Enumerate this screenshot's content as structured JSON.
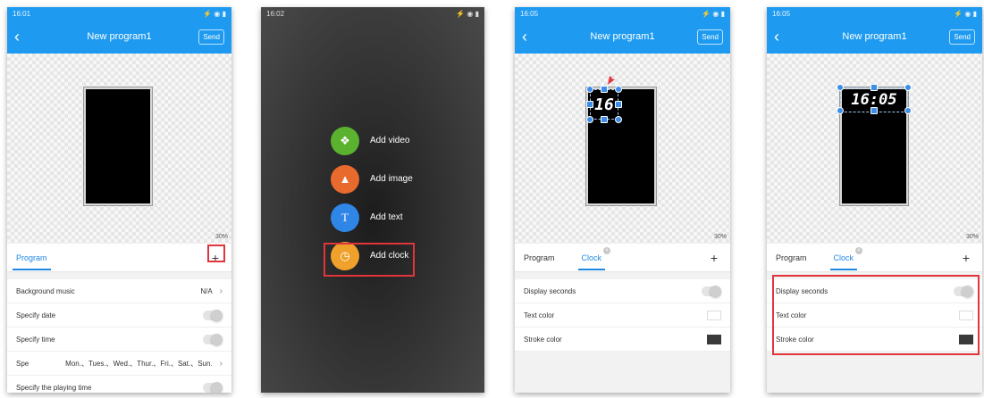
{
  "app": {
    "title": "New program1",
    "send_label": "Send",
    "back_icon": "back-arrow-icon"
  },
  "colors": {
    "accent": "#1e9bf0",
    "tab_active": "#1e88e5",
    "highlight": "#e0353b"
  },
  "screens": [
    {
      "time": "16:01",
      "zoom": "30%",
      "tabs": [
        "Program"
      ],
      "plus": "+",
      "rows": [
        {
          "label": "Background music",
          "value": "N/A",
          "control": "chevron"
        },
        {
          "label": "Specify date",
          "control": "toggle"
        },
        {
          "label": "Specify time",
          "control": "toggle"
        },
        {
          "label": "Spe",
          "value": "Mon.、Tues.、Wed.、Thur.、Fri.、Sat.、Sun.",
          "control": "chevron"
        },
        {
          "label": "Specify the playing time",
          "control": "toggle"
        }
      ]
    },
    {
      "time": "16:02",
      "menu": [
        {
          "label": "Add video",
          "icon": "video-icon",
          "color": "#5bb22e"
        },
        {
          "label": "Add image",
          "icon": "image-icon",
          "color": "#e96a2d"
        },
        {
          "label": "Add text",
          "icon": "text-icon",
          "color": "#2f86e6"
        },
        {
          "label": "Add clock",
          "icon": "clock-icon",
          "color": "#f0a12b"
        }
      ]
    },
    {
      "time": "16:05",
      "zoom": "30%",
      "clock_text": "16",
      "tabs": [
        "Program",
        "Clock"
      ],
      "plus": "+",
      "rows": [
        {
          "label": "Display seconds",
          "control": "toggle"
        },
        {
          "label": "Text color",
          "control": "swatch-white"
        },
        {
          "label": "Stroke color",
          "control": "swatch-dark"
        }
      ]
    },
    {
      "time": "16:05",
      "zoom": "30%",
      "clock_text": "16:05",
      "tabs": [
        "Program",
        "Clock"
      ],
      "plus": "+",
      "rows": [
        {
          "label": "Display seconds",
          "control": "toggle"
        },
        {
          "label": "Text color",
          "control": "swatch-white"
        },
        {
          "label": "Stroke color",
          "control": "swatch-dark"
        }
      ]
    }
  ]
}
